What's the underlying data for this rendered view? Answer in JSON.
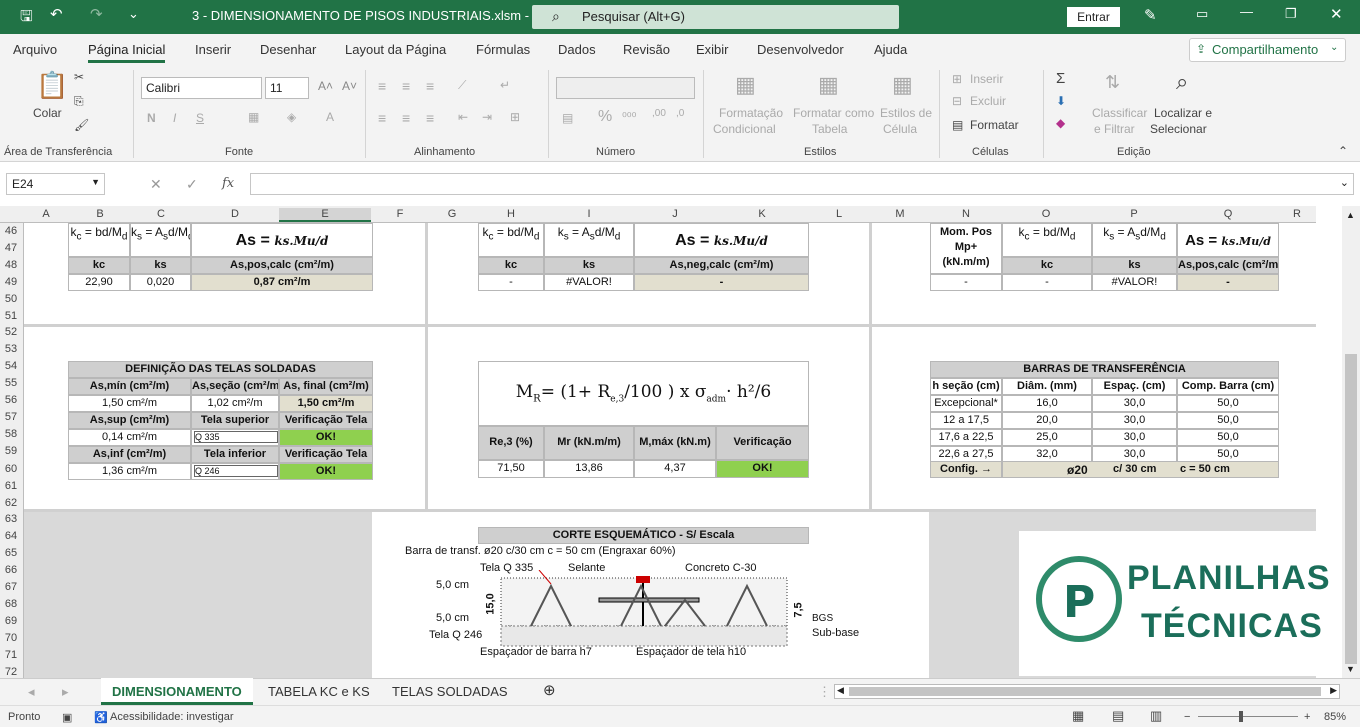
{
  "titlebar": {
    "title": "3 - DIMENSIONAMENTO DE PISOS INDUSTRIAIS.xlsm  -  Excel",
    "search": "Pesquisar (Alt+G)",
    "signin": "Entrar"
  },
  "menu": [
    "Arquivo",
    "Página Inicial",
    "Inserir",
    "Desenhar",
    "Layout da Página",
    "Fórmulas",
    "Dados",
    "Revisão",
    "Exibir",
    "Desenvolvedor",
    "Ajuda"
  ],
  "share": "Compartilhamento",
  "ribbon": {
    "paste": "Colar",
    "clipboard": "Área de Transferência",
    "font_name": "Calibri",
    "font_size": "11",
    "font": "Fonte",
    "alignment": "Alinhamento",
    "number": "Número",
    "cond_format": "Formatação",
    "cond_format2": "Condicional",
    "format_table": "Formatar como",
    "format_table2": "Tabela",
    "cell_styles": "Estilos de",
    "cell_styles2": "Célula",
    "styles": "Estilos",
    "insert": "Inserir",
    "delete": "Excluir",
    "format": "Formatar",
    "cells": "Células",
    "sort": "Classificar",
    "sort2": "e Filtrar",
    "find": "Localizar e",
    "find2": "Selecionar",
    "editing": "Edição"
  },
  "namebox": "E24",
  "columns": [
    "A",
    "B",
    "C",
    "D",
    "E",
    "F",
    "G",
    "H",
    "I",
    "J",
    "K",
    "L",
    "M",
    "N",
    "O",
    "P",
    "Q",
    "R"
  ],
  "rows": [
    "46",
    "47",
    "48",
    "49",
    "50",
    "51",
    "52",
    "53",
    "54",
    "55",
    "56",
    "57",
    "58",
    "59",
    "60",
    "61",
    "62",
    "63",
    "64",
    "65",
    "66",
    "67",
    "68",
    "69",
    "70",
    "71",
    "72"
  ],
  "sheet": {
    "t1": {
      "h": [
        "kc",
        "ks",
        "As,pos,calc (cm²/m)"
      ],
      "v": [
        "22,90",
        "0,020",
        "0,87 cm²/m"
      ],
      "formula": "As ="
    },
    "t2": {
      "h": [
        "kc",
        "ks",
        "As,neg,calc (cm²/m)"
      ],
      "v": [
        "-",
        "#VALOR!",
        "-"
      ],
      "formula": "As ="
    },
    "t3": {
      "h0": "Mom. Pos",
      "h1": "Mp+",
      "h2": "(kN.m/m)",
      "h": [
        "kc",
        "ks",
        "As,pos,calc (cm²/m)"
      ],
      "v": [
        "-",
        "-",
        "#VALOR!",
        "-"
      ],
      "formula": "As ="
    },
    "telas": {
      "title": "DEFINIÇÃO DAS TELAS SOLDADAS",
      "h1": [
        "As,mín (cm²/m)",
        "As,seção (cm²/m)",
        "As, final (cm²/m)"
      ],
      "v1": [
        "1,50 cm²/m",
        "1,02 cm²/m",
        "1,50 cm²/m"
      ],
      "h2": [
        "As,sup (cm²/m)",
        "Tela superior",
        "Verificação Tela"
      ],
      "v2": [
        "0,14 cm²/m",
        "Q 335",
        "OK!"
      ],
      "h3": [
        "As,inf (cm²/m)",
        "Tela inferior",
        "Verificação Tela"
      ],
      "v3": [
        "1,36 cm²/m",
        "Q 246",
        "OK!"
      ]
    },
    "mr": {
      "formula_a": "M",
      "formula_b": "= (1+",
      "formula_c": "R",
      "formula_d": "100",
      "formula_e": ") x",
      "formula_f": "σ",
      "formula_g": "· h²",
      "formula_h": "6",
      "h": [
        "Re,3 (%)",
        "Mr (kN.m/m)",
        "M,máx (kN.m)",
        "Verificação"
      ],
      "v": [
        "71,50",
        "13,86",
        "4,37",
        "OK!"
      ]
    },
    "barras": {
      "title": "BARRAS DE TRANSFERÊNCIA",
      "h": [
        "h seção (cm)",
        "Diâm. (mm)",
        "Espaç. (cm)",
        "Comp. Barra (cm)"
      ],
      "rows": [
        [
          "Excepcional*",
          "16,0",
          "30,0",
          "50,0"
        ],
        [
          "12 a 17,5",
          "20,0",
          "30,0",
          "50,0"
        ],
        [
          "17,6 a 22,5",
          "25,0",
          "30,0",
          "50,0"
        ],
        [
          "22,6 a 27,5",
          "32,0",
          "30,0",
          "50,0"
        ]
      ],
      "config": "Config. →",
      "diam": "ø20",
      "esp": "c/ 30 cm",
      "comp": "c = 50 cm"
    },
    "corte": {
      "title": "CORTE ESQUEMÁTICO - S/ Escala",
      "barra": "Barra de transf. ø20 c/30 cm c = 50 cm (Engraxar 60%)",
      "tela_sup": "Tela Q 335",
      "selante": "Selante",
      "concreto": "Concreto C-30",
      "d1": "5,0 cm",
      "d2": "5,0 cm",
      "h": "15,0",
      "tela_inf": "Tela Q 246",
      "esp_barra": "Espaçador de barra h7",
      "esp_tela": "Espaçador de tela h10",
      "bgs_dim": "7,5",
      "bgs": "BGS",
      "subbase": "Sub-base"
    },
    "logo": {
      "l1": "PLANILHAS",
      "l2": "TÉCNICAS"
    }
  },
  "tabs": [
    "DIMENSIONAMENTO",
    "TABELA KC e KS",
    "TELAS SOLDADAS"
  ],
  "status": {
    "ready": "Pronto",
    "access": "Acessibilidade: investigar",
    "zoom": "85%"
  }
}
